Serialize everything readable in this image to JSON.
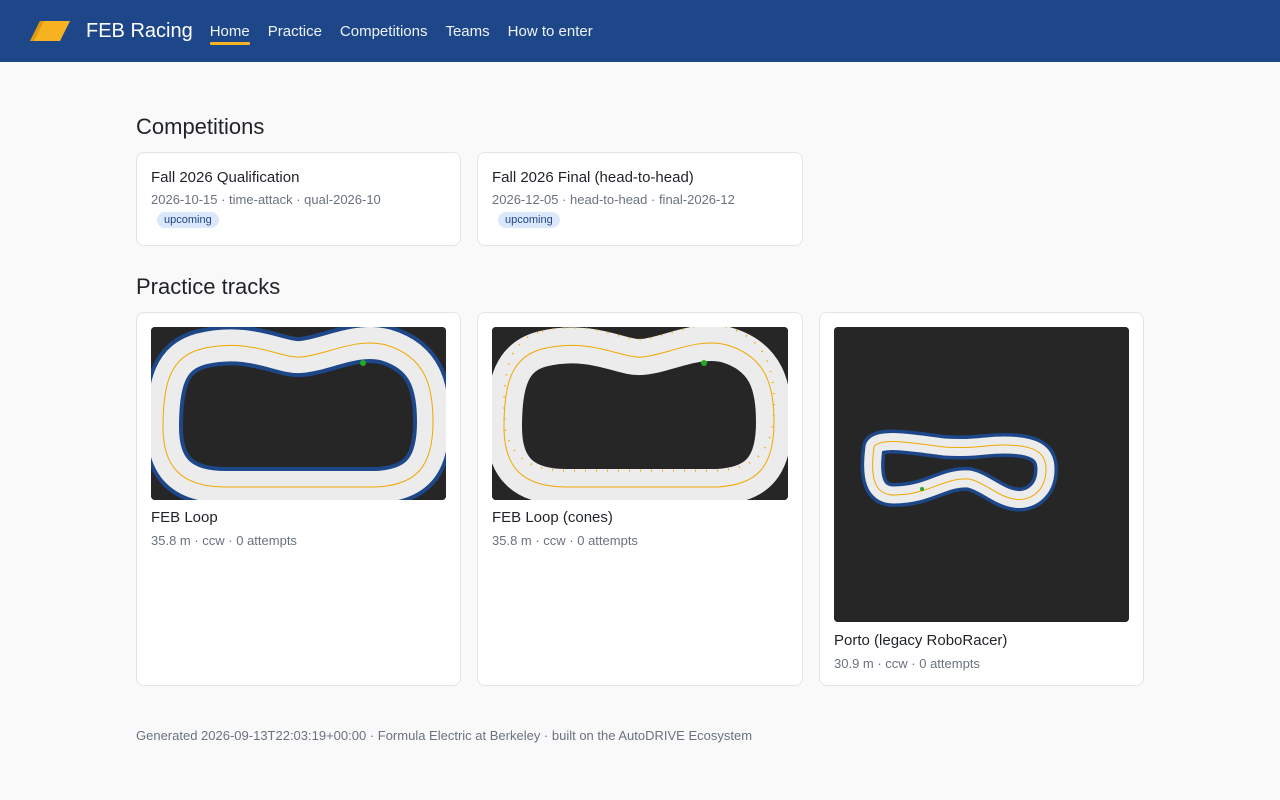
{
  "site": {
    "brand": "FEB Racing"
  },
  "nav": [
    {
      "label": "Home",
      "active": true
    },
    {
      "label": "Practice"
    },
    {
      "label": "Competitions"
    },
    {
      "label": "Teams"
    },
    {
      "label": "How to enter"
    }
  ],
  "competitions": {
    "heading": "Competitions",
    "items": [
      {
        "title": "Fall 2026 Qualification",
        "meta": "2026-10-15 · time-attack · qual-2026-10",
        "status": "upcoming"
      },
      {
        "title": "Fall 2026 Final (head-to-head)",
        "meta": "2026-12-05 · head-to-head · final-2026-12",
        "status": "upcoming"
      }
    ]
  },
  "practice": {
    "heading": "Practice tracks",
    "items": [
      {
        "name": "FEB Loop",
        "meta": "35.8 m · ccw · 0 attempts"
      },
      {
        "name": "FEB Loop (cones)",
        "meta": "35.8 m · ccw · 0 attempts"
      },
      {
        "name": "Porto (legacy RoboRacer)",
        "meta": "30.9 m · ccw · 0 attempts"
      }
    ]
  },
  "footer": {
    "text": "Generated 2026-09-13T22:03:19+00:00 · Formula Electric at Berkeley · built on the AutoDRIVE Ecosystem"
  },
  "colors": {
    "header": "#1e4789",
    "accent": "#f6b220",
    "track_border": "#1e4789",
    "racing_line": "#f0a800",
    "start_marker": "#22aa22"
  }
}
